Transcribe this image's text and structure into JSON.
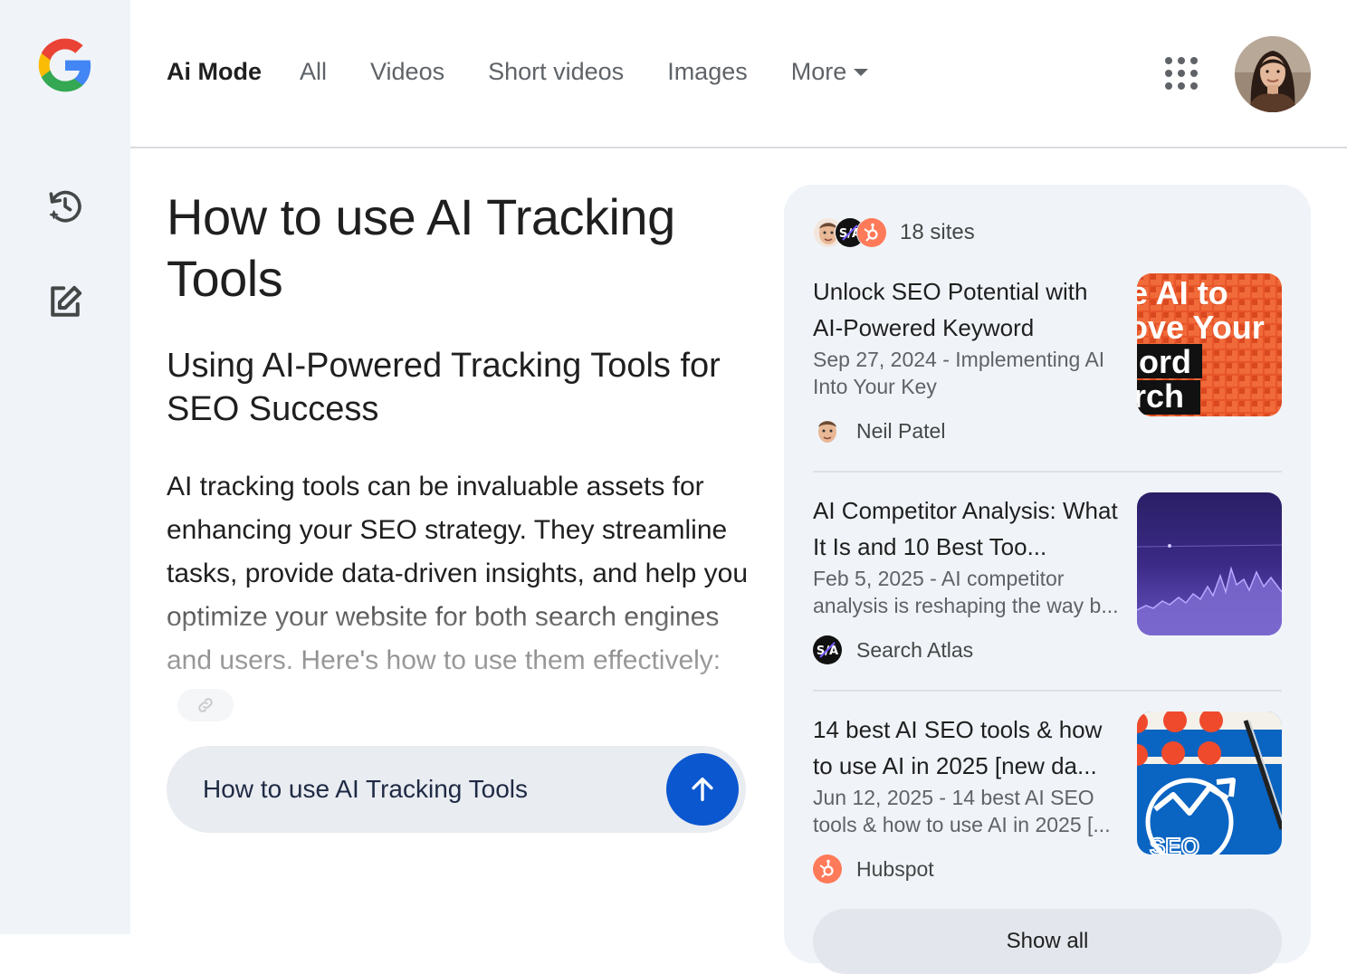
{
  "rail": {
    "logo_icon": "google-g-icon",
    "history_icon": "history-icon",
    "new_chat_icon": "new-chat-icon"
  },
  "tabs": [
    {
      "label": "Ai Mode",
      "active": true
    },
    {
      "label": "All"
    },
    {
      "label": "Videos"
    },
    {
      "label": "Short videos"
    },
    {
      "label": "Images"
    },
    {
      "label": "More"
    }
  ],
  "header": {
    "apps_icon": "apps-grid-icon",
    "avatar_icon": "user-avatar"
  },
  "answer": {
    "title": "How to use AI Tracking Tools",
    "subtitle": "Using AI-Powered Tracking Tools for SEO Success",
    "paragraph": "AI tracking tools can be invaluable assets for enhancing your SEO strategy. They streamline tasks, provide data-driven insights, and help you optimize your website for both search engines and users. Here's how to use them effectively:",
    "link_icon": "link-icon"
  },
  "ask_box": {
    "text": "How to use AI Tracking Tools",
    "send_icon": "arrow-up-icon"
  },
  "sources": {
    "count": "18 sites",
    "cards": [
      {
        "title": "Unlock SEO Potential with AI-Powered Keyword",
        "snippet": "Sep 27, 2024 - Implementing AI Into Your Key",
        "site": "Neil Patel",
        "thumb_text": [
          "e AI to",
          "ove Your",
          "ord",
          "rch"
        ]
      },
      {
        "title": "AI Competitor Analysis: What It Is and 10 Best Too...",
        "snippet": "Feb 5, 2025 - AI competitor analysis is reshaping the way b...",
        "site": "Search Atlas"
      },
      {
        "title": "14 best AI SEO tools & how to use AI in 2025 [new da...",
        "snippet": "Jun 12, 2025 - 14 best AI SEO tools & how to use AI in 2025 [...",
        "site": "Hubspot",
        "thumb_text": [
          "SEO"
        ]
      }
    ],
    "show_all": "Show all"
  },
  "colors": {
    "accent": "#0b57d0",
    "rail_bg": "#f0f4f9",
    "hubspot": "#ff7a59"
  }
}
